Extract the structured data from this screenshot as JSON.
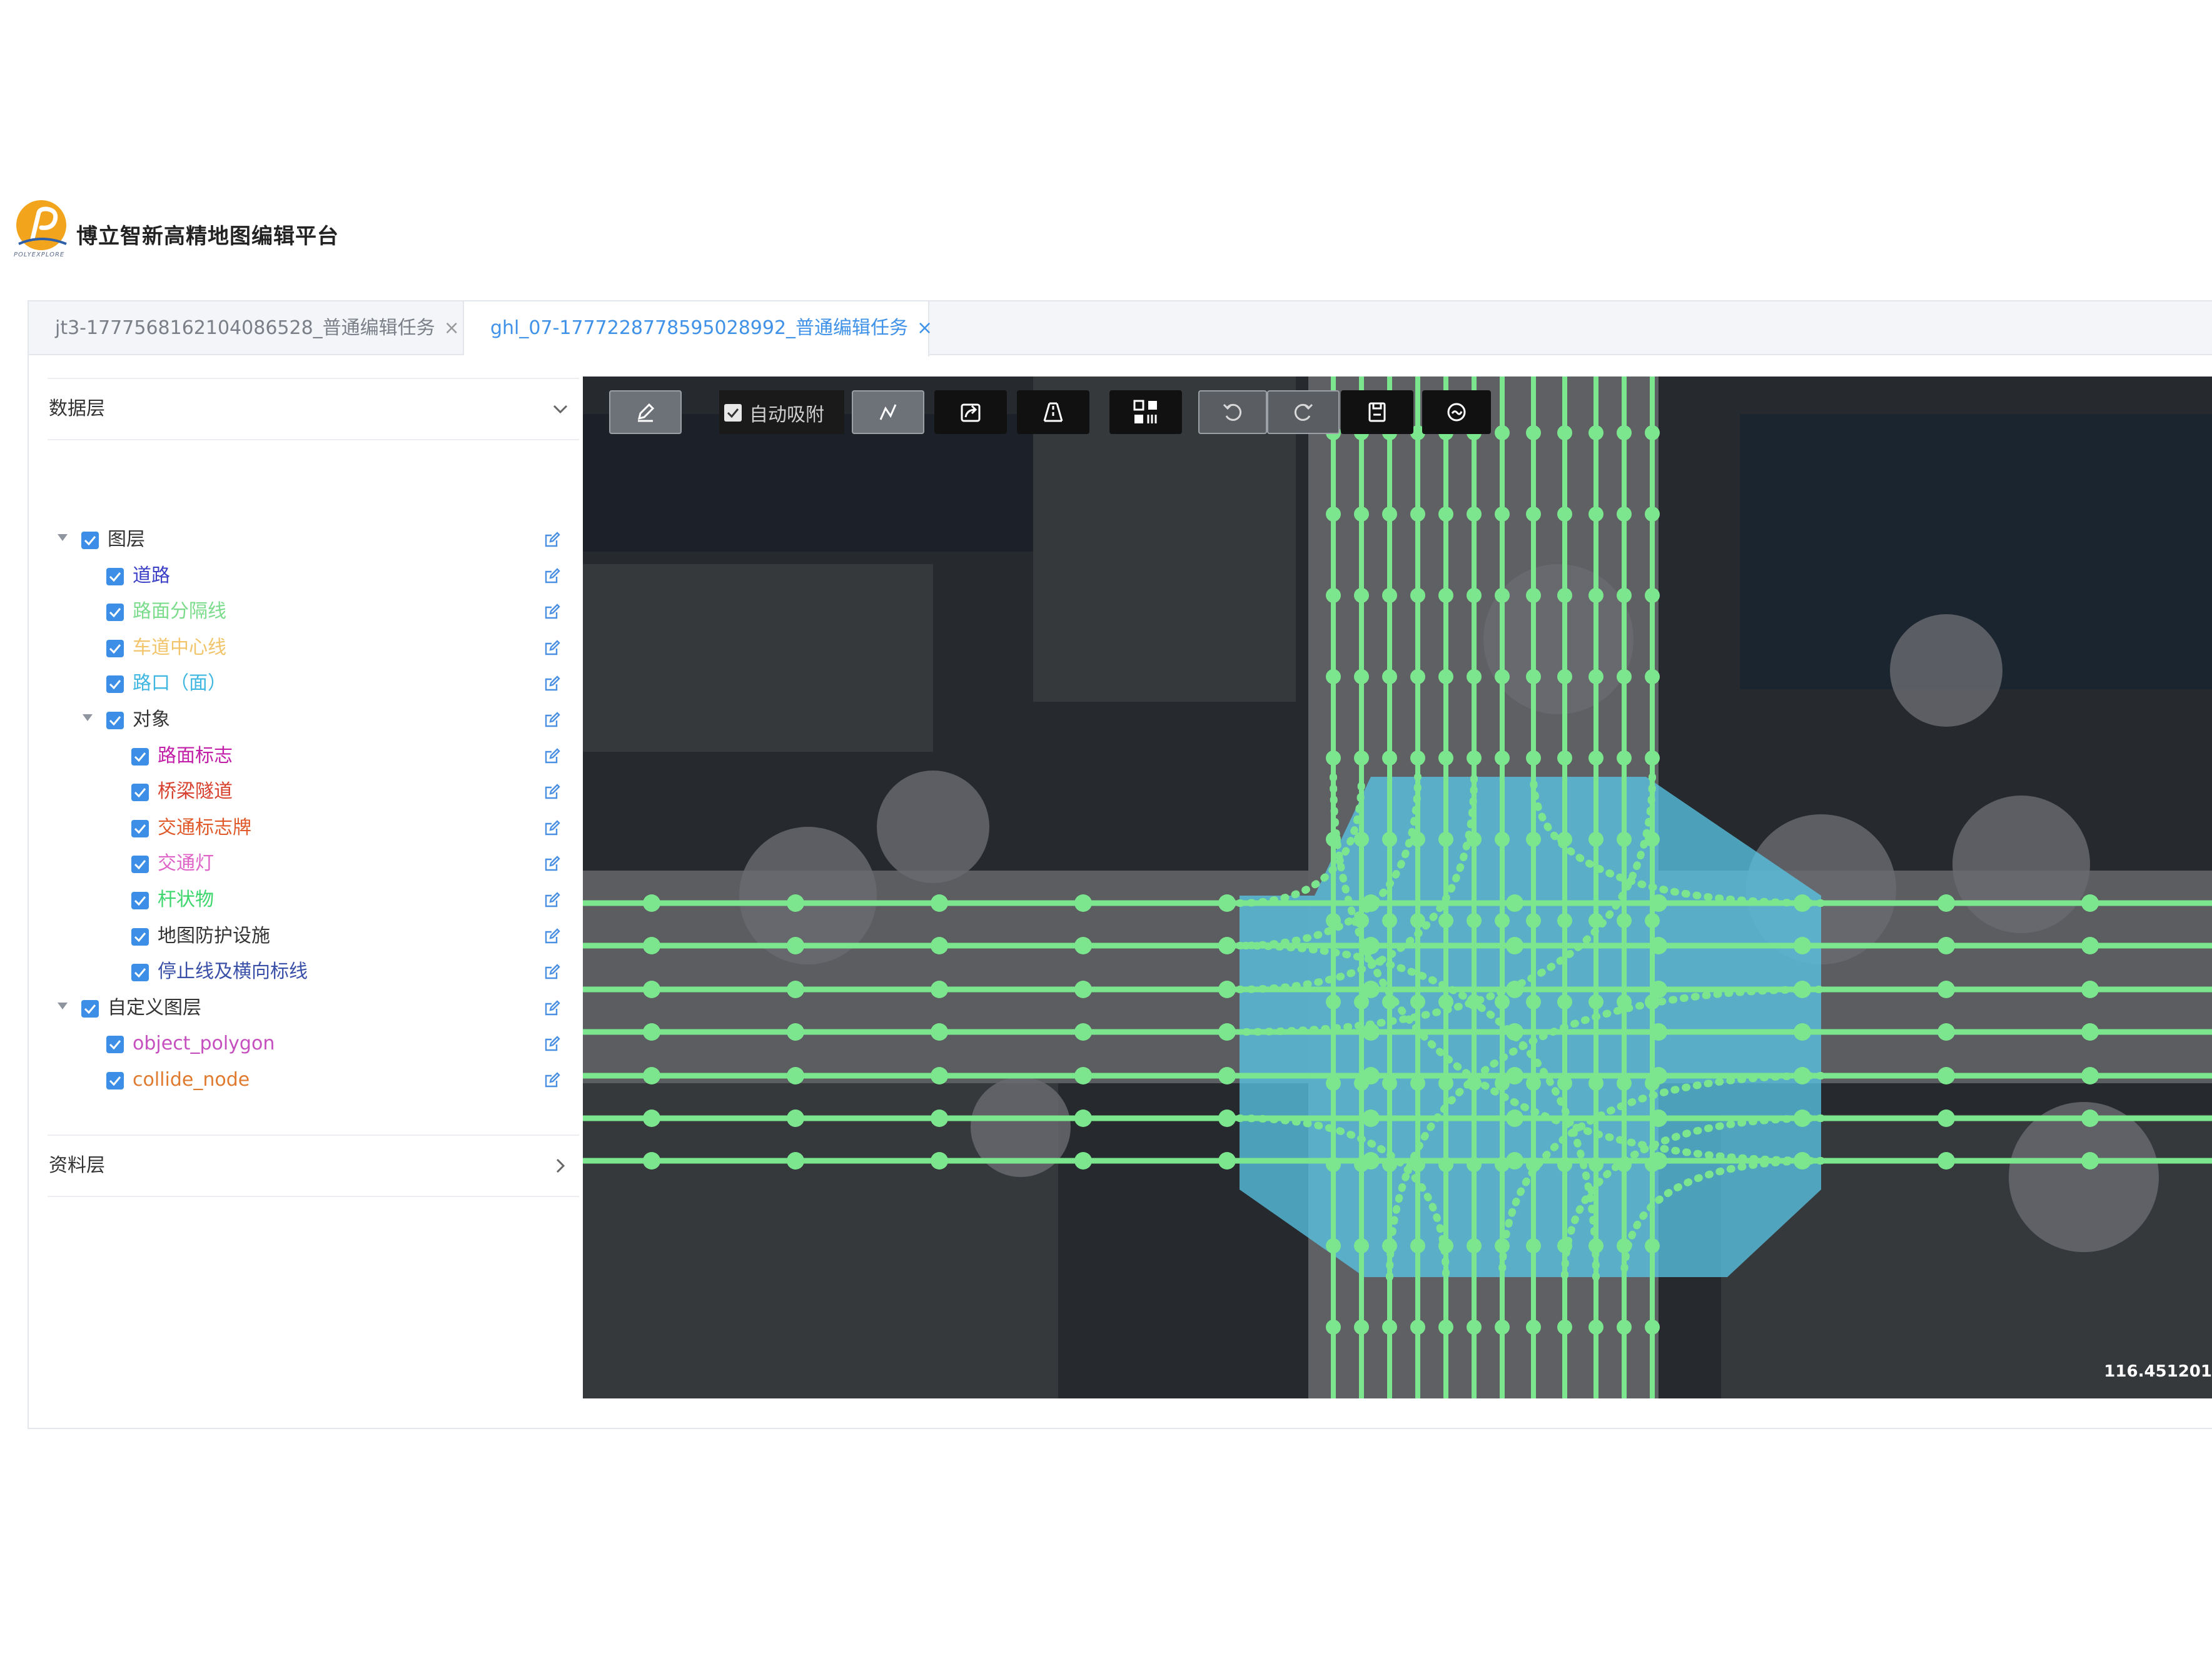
{
  "brand": {
    "title": "博立智新高精地图编辑平台",
    "logo_sub": "POLYEXPLORE",
    "logo_color": "#f0a020"
  },
  "tabs": [
    {
      "label": "jt3-1777568162104086528_普通编辑任务",
      "close": "×",
      "active": false
    },
    {
      "label": "ghl_07-1777228778595028992_普通编辑任务",
      "close": "×",
      "active": true
    }
  ],
  "sidebar": {
    "data_layer": {
      "label": "数据层",
      "expanded": true
    },
    "source_layer": {
      "label": "资料层",
      "expanded": false
    },
    "tree": {
      "layers": {
        "label": "图层",
        "color": "#333333"
      },
      "road": {
        "label": "道路",
        "color": "#3b3fc6"
      },
      "separator": {
        "label": "路面分隔线",
        "color": "#7bdc8c"
      },
      "centerline": {
        "label": "车道中心线",
        "color": "#f2c46b"
      },
      "junction": {
        "label": "路口（面）",
        "color": "#3fb7e0"
      },
      "objects": {
        "label": "对象",
        "color": "#333333"
      },
      "road_marking": {
        "label": "路面标志",
        "color": "#c21fa8"
      },
      "bridge_tunnel": {
        "label": "桥梁隧道",
        "color": "#d8402e"
      },
      "traffic_sign": {
        "label": "交通标志牌",
        "color": "#e05a2b"
      },
      "traffic_light": {
        "label": "交通灯",
        "color": "#e064c8"
      },
      "pole": {
        "label": "杆状物",
        "color": "#3cd66c"
      },
      "guard": {
        "label": "地图防护设施",
        "color": "#333333"
      },
      "stop_line": {
        "label": "停止线及横向标线",
        "color": "#3a4fa8"
      },
      "custom": {
        "label": "自定义图层",
        "color": "#333333"
      },
      "object_polygon": {
        "label": "object_polygon",
        "color": "#c64fbf"
      },
      "collide_node": {
        "label": "collide_node",
        "color": "#e07a2e"
      }
    }
  },
  "toolbar": {
    "auto_snap_label": "自动吸附",
    "auto_snap_checked": true
  },
  "map": {
    "coordinate": "116.451201",
    "lane_color": "#7ce68e",
    "junction_color": "#5ac8e8"
  }
}
